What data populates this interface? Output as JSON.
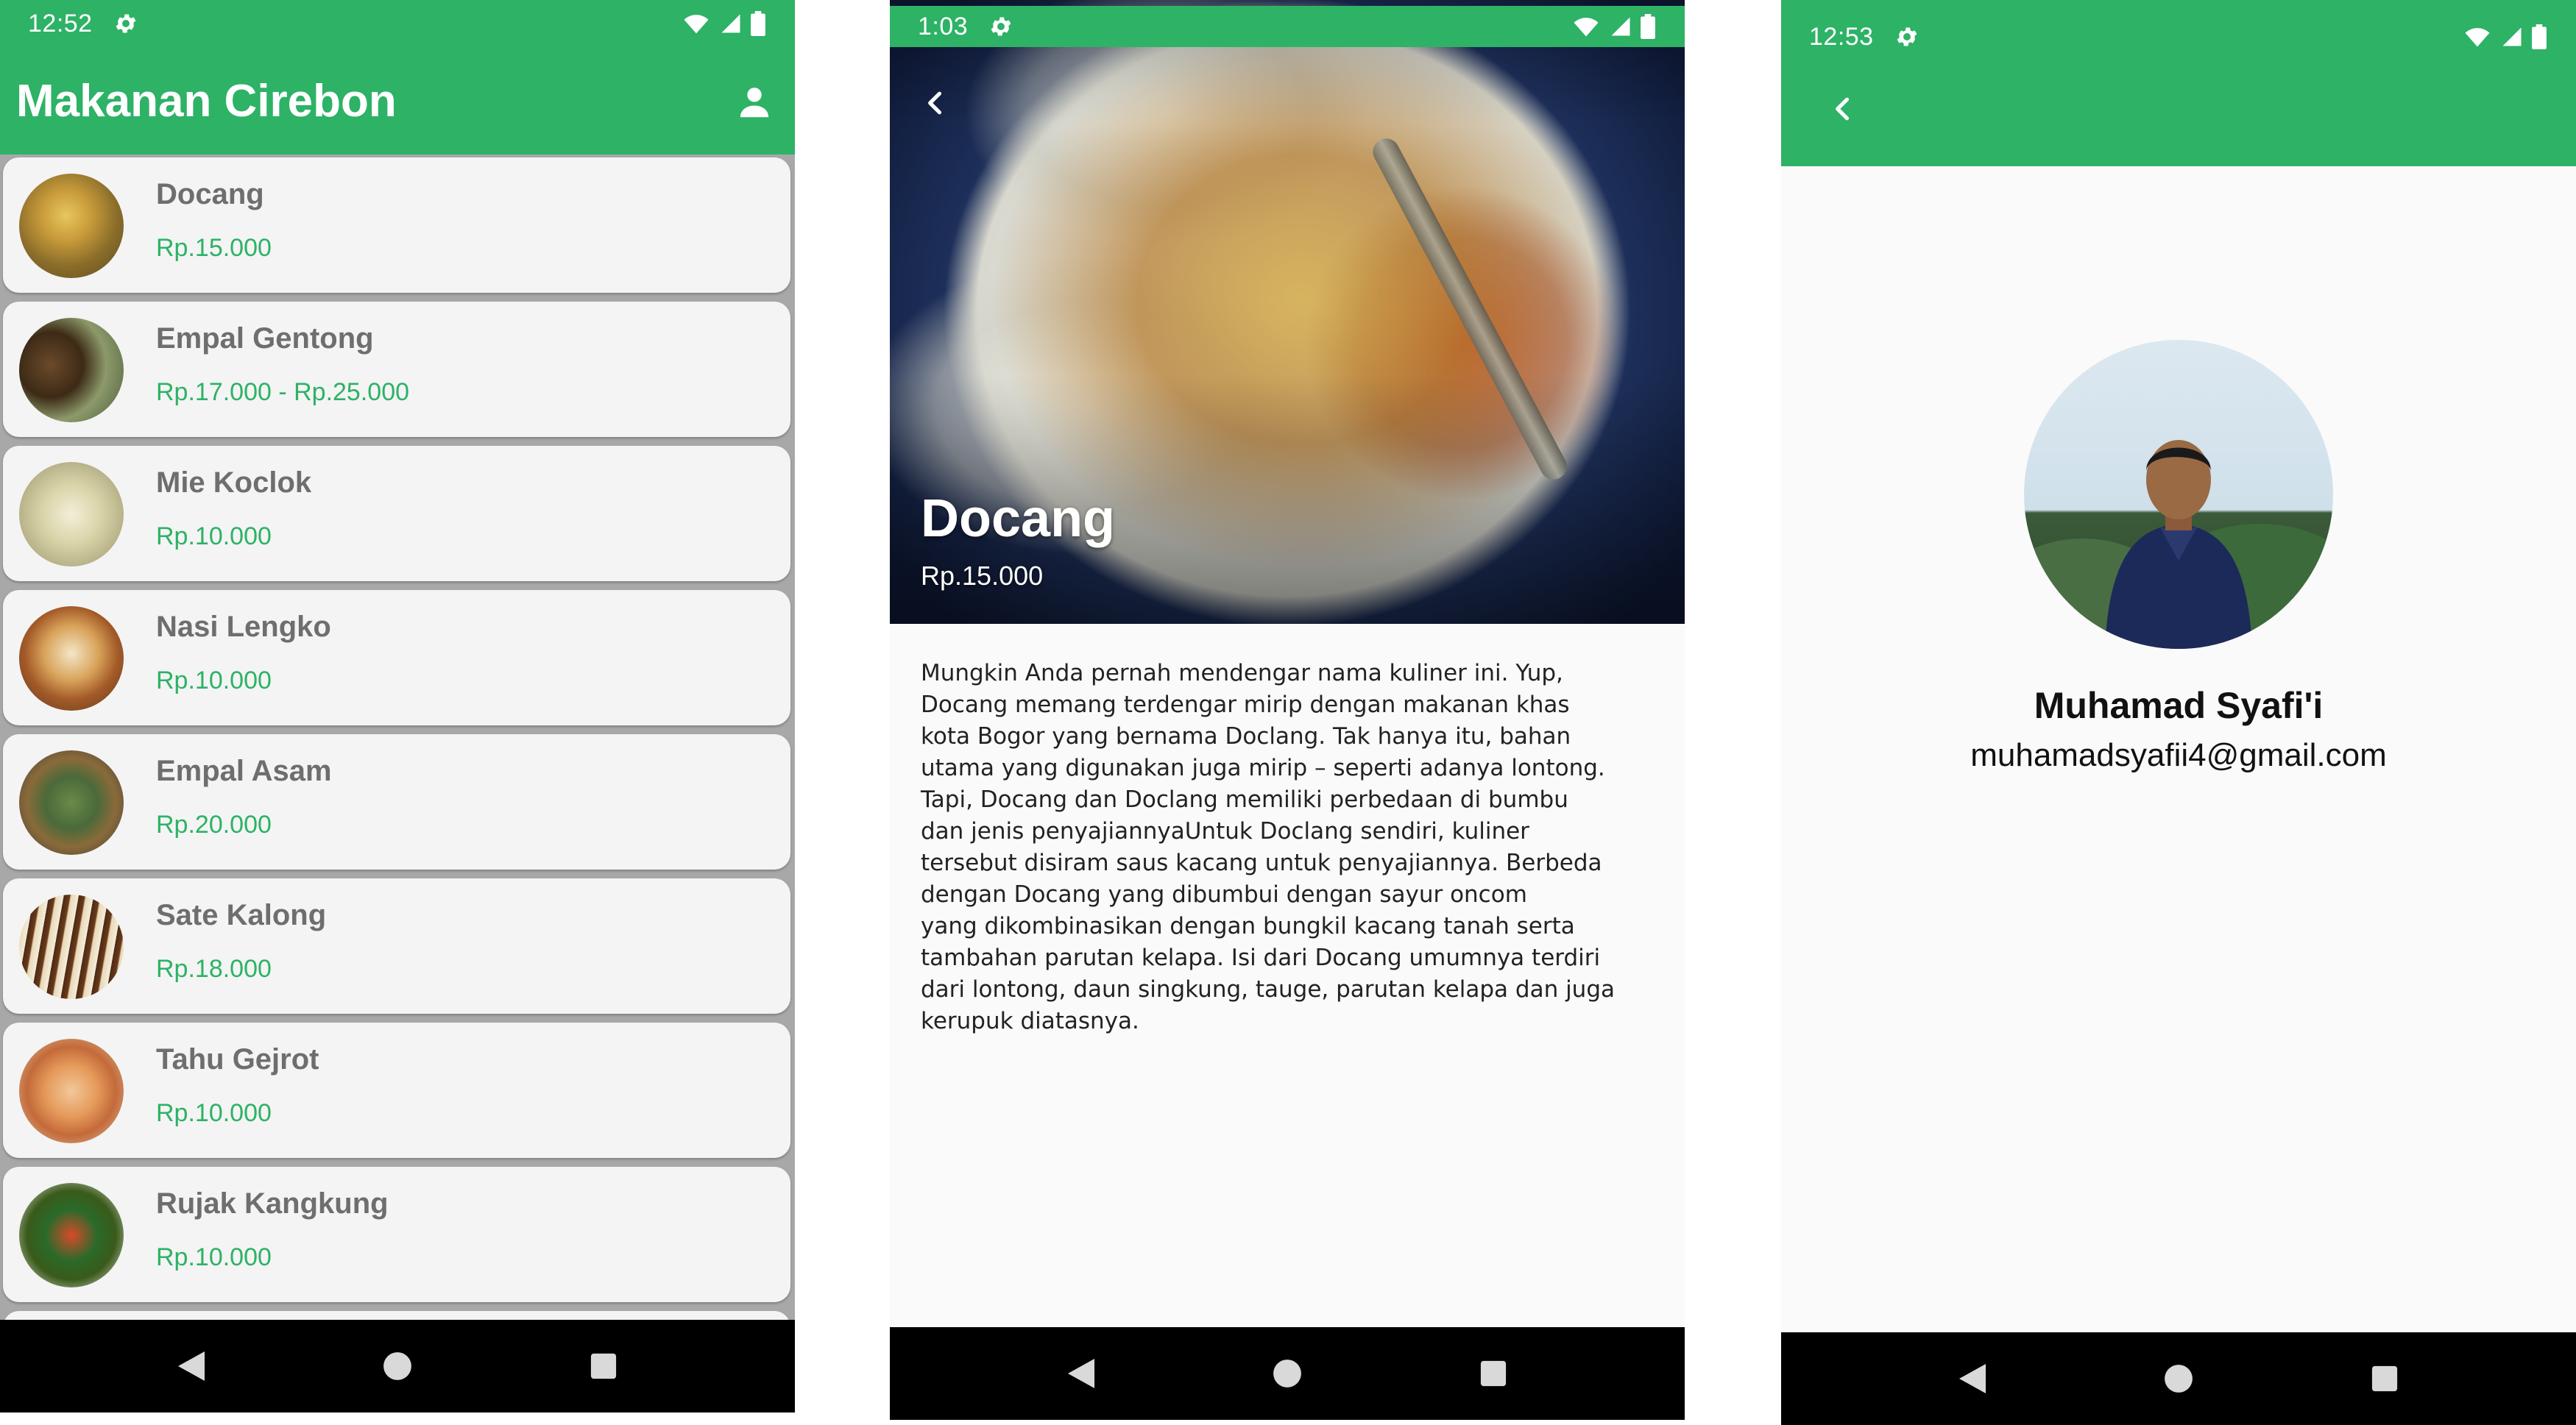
{
  "screens": {
    "list": {
      "status_time": "12:52",
      "app_title": "Makanan Cirebon",
      "items": [
        {
          "name": "Docang",
          "price": "Rp.15.000"
        },
        {
          "name": "Empal Gentong",
          "price": "Rp.17.000 - Rp.25.000"
        },
        {
          "name": "Mie Koclok",
          "price": "Rp.10.000"
        },
        {
          "name": "Nasi Lengko",
          "price": "Rp.10.000"
        },
        {
          "name": "Empal Asam",
          "price": "Rp.20.000"
        },
        {
          "name": "Sate Kalong",
          "price": "Rp.18.000"
        },
        {
          "name": "Tahu Gejrot",
          "price": "Rp.10.000"
        },
        {
          "name": "Rujak Kangkung",
          "price": "Rp.10.000"
        }
      ]
    },
    "detail": {
      "status_time": "1:03",
      "title": "Docang",
      "price": "Rp.15.000",
      "description": "Mungkin Anda pernah mendengar nama kuliner ini. Yup,\nDocang memang terdengar mirip dengan makanan khas\nkota Bogor yang bernama Doclang. Tak hanya itu, bahan\nutama yang digunakan juga mirip – seperti adanya lontong.\nTapi, Docang dan Doclang memiliki perbedaan di bumbu\ndan jenis penyajiannyaUntuk Doclang sendiri, kuliner\ntersebut disiram saus kacang untuk penyajiannya. Berbeda\ndengan Docang yang dibumbui dengan sayur oncom\nyang dikombinasikan dengan bungkil kacang tanah serta\ntambahan parutan kelapa. Isi dari Docang umumnya terdiri\ndari lontong, daun singkung, tauge, parutan kelapa dan juga\nkerupuk diatasnya."
    },
    "profile": {
      "status_time": "12:53",
      "name": "Muhamad Syafi'i",
      "email": "muhamadsyafii4@gmail.com"
    }
  },
  "colors": {
    "primary": "#2db266",
    "card": "#f4f4f4",
    "list_bg": "#a8a8a8",
    "navbar": "#000000"
  },
  "icons": [
    "settings-icon",
    "wifi-icon",
    "signal-icon",
    "battery-icon",
    "person-icon",
    "back-arrow-icon",
    "nav-back-icon",
    "nav-home-icon",
    "nav-recents-icon"
  ]
}
